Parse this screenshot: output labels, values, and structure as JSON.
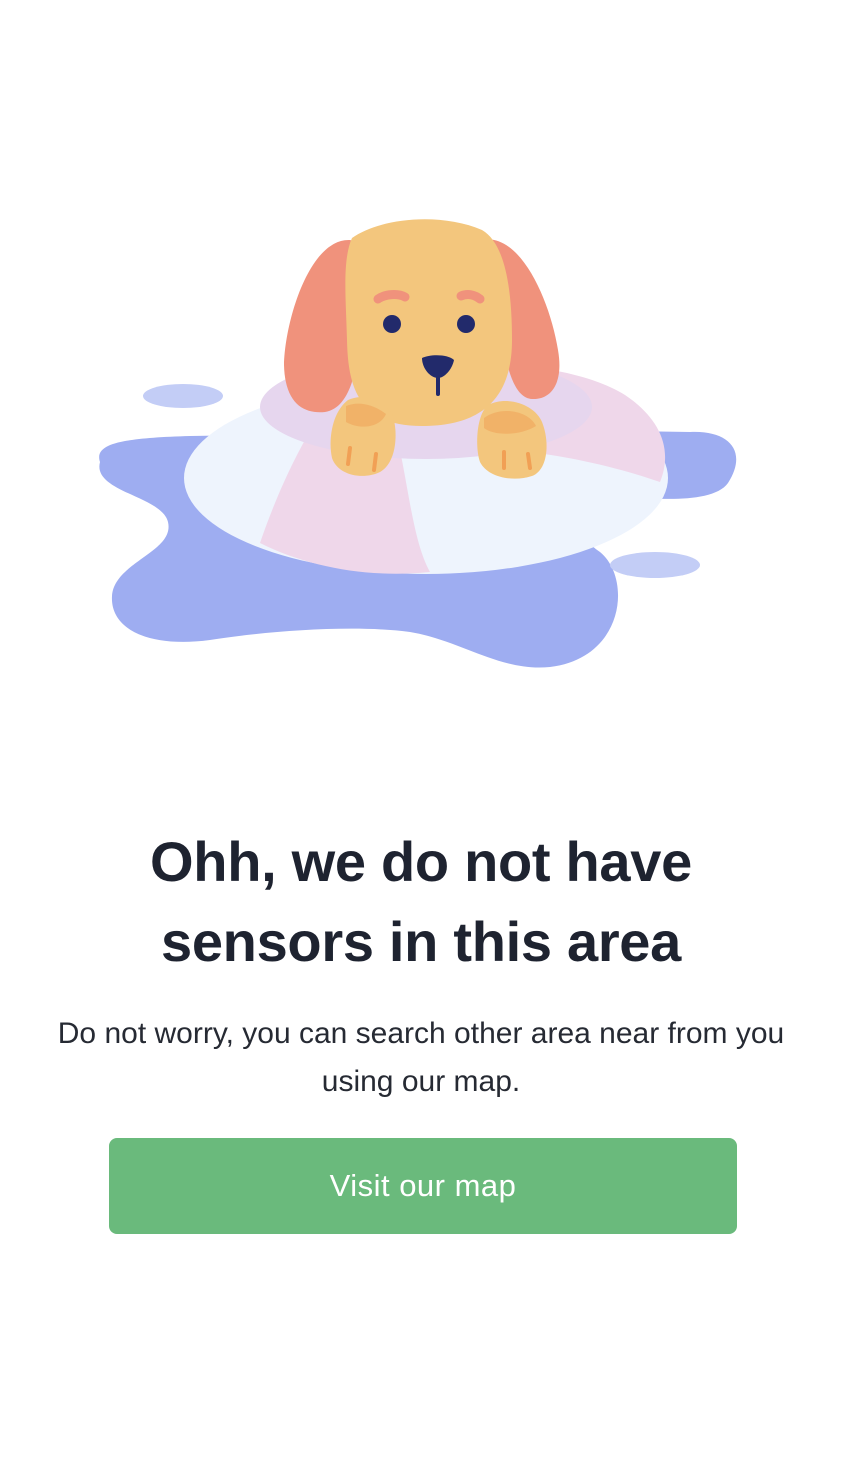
{
  "empty_state": {
    "illustration_icon": "dog-in-swim-ring-illustration",
    "title": "Ohh, we do not have sensors in this area",
    "description": "Do not worry, you can search other area near from you using our map.",
    "cta_label": "Visit our map"
  },
  "colors": {
    "background": "#ffffff",
    "title": "#1e2330",
    "text": "#262a33",
    "button": "#6aba7c",
    "button_text": "#ffffff",
    "water": "#9eadf1",
    "ring_white": "#eef4fd",
    "ring_pink": "#efd7ea",
    "dog_fur": "#f3c67d",
    "dog_ears": "#f0927c",
    "dog_paws": "#f1b268",
    "dog_eyes": "#222a6b"
  }
}
